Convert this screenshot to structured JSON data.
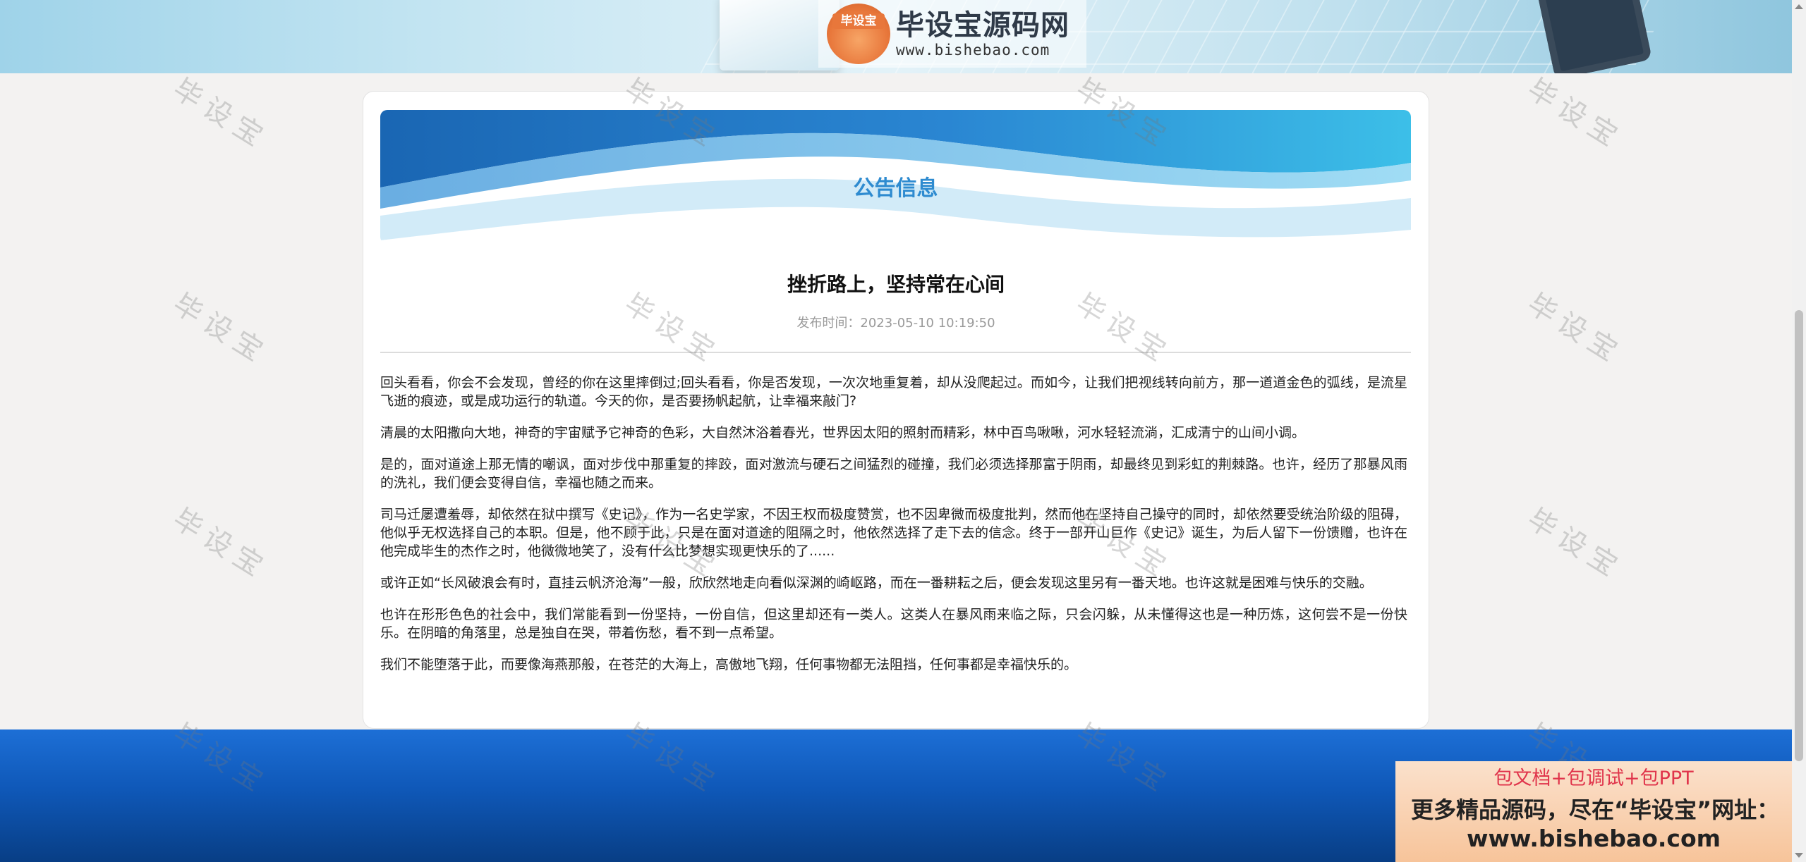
{
  "site": {
    "logo_badge": "毕设宝",
    "logo_title": "毕设宝源码网",
    "logo_url": "www.bishebao.com"
  },
  "page": {
    "section_title": "公告信息"
  },
  "article": {
    "title": "挫折路上，坚持常在心间",
    "meta": "发布时间：2023-05-10 10:19:50",
    "paragraphs": [
      "回头看看，你会不会发现，曾经的你在这里摔倒过;回头看看，你是否发现，一次次地重复着，却从没爬起过。而如今，让我们把视线转向前方，那一道道金色的弧线，是流星飞逝的痕迹，或是成功运行的轨道。今天的你，是否要扬帆起航，让幸福来敲门?",
      "清晨的太阳撒向大地，神奇的宇宙赋予它神奇的色彩，大自然沐浴着春光，世界因太阳的照射而精彩，林中百鸟啾啾，河水轻轻流淌，汇成清宁的山间小调。",
      "是的，面对道途上那无情的嘲讽，面对步伐中那重复的摔跤，面对激流与硬石之间猛烈的碰撞，我们必须选择那富于阴雨，却最终见到彩虹的荆棘路。也许，经历了那暴风雨的洗礼，我们便会变得自信，幸福也随之而来。",
      "司马迁屡遭羞辱，却依然在狱中撰写《史记》，作为一名史学家，不因王权而极度赞赏，也不因卑微而极度批判，然而他在坚持自己操守的同时，却依然要受统治阶级的阻碍，他似乎无权选择自己的本职。但是，他不顾于此，只是在面对道途的阻隔之时，他依然选择了走下去的信念。终于一部开山巨作《史记》诞生，为后人留下一份馈赠，也许在他完成毕生的杰作之时，他微微地笑了，没有什么比梦想实现更快乐的了......",
      "或许正如“长风破浪会有时，直挂云帆济沧海”一般，欣欣然地走向看似深渊的崎岖路，而在一番耕耘之后，便会发现这里另有一番天地。也许这就是困难与快乐的交融。",
      "也许在形形色色的社会中，我们常能看到一份坚持，一份自信，但这里却还有一类人。这类人在暴风雨来临之际，只会闪躲，从未懂得这也是一种历炼，这何尝不是一份快乐。在阴暗的角落里，总是独自在哭，带着伤愁，看不到一点希望。",
      "我们不能堕落于此，而要像海燕那般，在苍茫的大海上，高傲地飞翔，任何事物都无法阻挡，任何事都是幸福快乐的。"
    ]
  },
  "watermark_text": "毕设宝",
  "ad": {
    "line1": "包文档+包调试+包PPT",
    "line2": "更多精品源码，尽在“毕设宝”网址：",
    "line3": "www.bishebao.com"
  }
}
